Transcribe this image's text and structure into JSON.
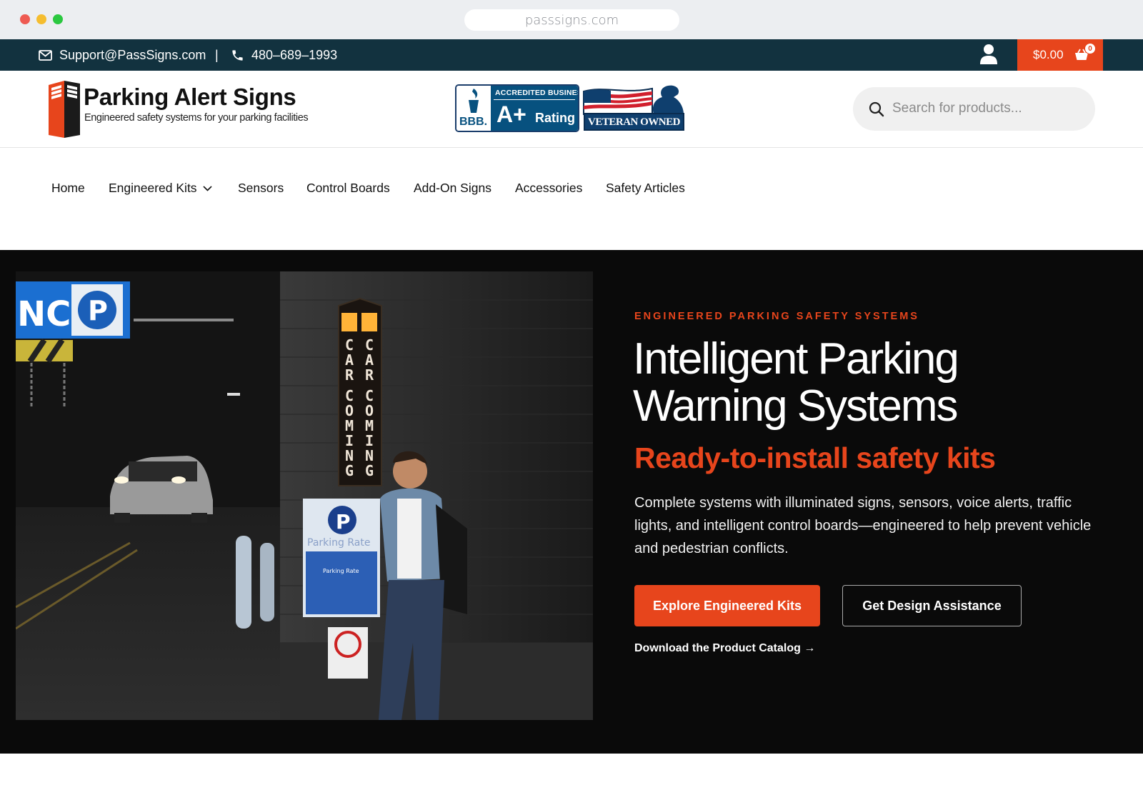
{
  "browser": {
    "url": "passsigns.com"
  },
  "topbar": {
    "email": "Support@PassSigns.com",
    "separator": "|",
    "phone": "480–689–1993",
    "cart_total": "$0.00",
    "cart_count": "0"
  },
  "header": {
    "logo_title": "Parking Alert Signs",
    "logo_subtitle": "Engineered safety systems for your parking facilities",
    "bbb": {
      "accredited": "ACCREDITED BUSINESS",
      "grade": "A+",
      "rating": "Rating",
      "bbb": "BBB."
    },
    "vob": "VETERAN OWNED BUSINESS",
    "search_placeholder": "Search for products..."
  },
  "nav": {
    "items": [
      {
        "label": "Home"
      },
      {
        "label": "Engineered Kits"
      },
      {
        "label": "Sensors"
      },
      {
        "label": "Control Boards"
      },
      {
        "label": "Add-On Signs"
      },
      {
        "label": "Accessories"
      },
      {
        "label": "Safety Articles"
      }
    ]
  },
  "hero": {
    "eyebrow": "ENGINEERED PARKING SAFETY SYSTEMS",
    "title_line1": "Intelligent Parking",
    "title_line2": "Warning Systems",
    "subtitle": "Ready-to-install safety kits",
    "description": "Complete systems with illuminated signs, sensors, voice alerts, traffic lights, and intelligent control boards—engineered to help prevent vehicle and pedestrian conflicts.",
    "primary_cta": "Explore Engineered Kits",
    "secondary_cta": "Get Design Assistance",
    "catalog_link": "Download the Product Catalog →",
    "photo": {
      "sign_text": "CAR COMING",
      "sign_letters": [
        "C",
        "A",
        "R",
        "C",
        "O",
        "M",
        "I",
        "N",
        "G"
      ],
      "entrance_text": "NCE",
      "parking_letter": "P",
      "parking_rate": "Parking Rate",
      "parking_rate_small": "Parking Rate"
    }
  },
  "colors": {
    "accent": "#e7451c",
    "topbar": "#12323f",
    "hero_bg": "#0a0a0a"
  }
}
